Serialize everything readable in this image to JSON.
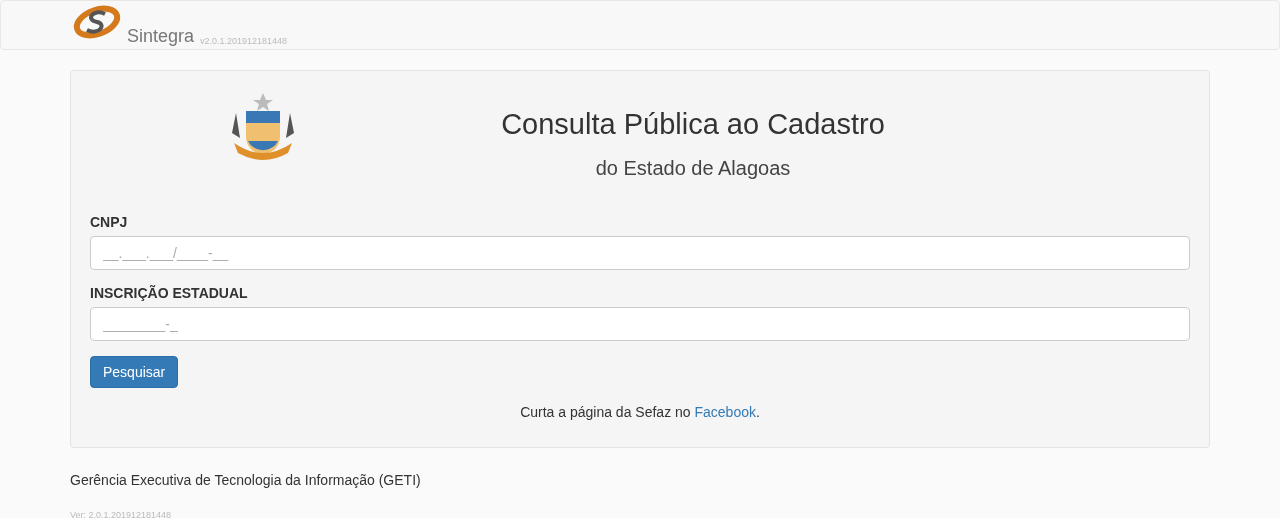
{
  "navbar": {
    "brand": "Sintegra",
    "version": "v2.0.1.201912181448"
  },
  "panel": {
    "title": "Consulta Pública ao Cadastro",
    "subtitle": "do Estado de Alagoas",
    "fields": [
      {
        "label": "CNPJ",
        "placeholder": "__.___.___/____-__"
      },
      {
        "label": "INSCRIÇÃO ESTADUAL",
        "placeholder": "________-_"
      }
    ],
    "button": "Pesquisar",
    "note": "Curta a página da Sefaz no ",
    "link": "Facebook",
    "note_end": "."
  },
  "footer": {
    "text": "Gerência Executiva de Tecnologia da Informação (GETI)",
    "version": "Ver: 2.0.1.201912181448"
  }
}
